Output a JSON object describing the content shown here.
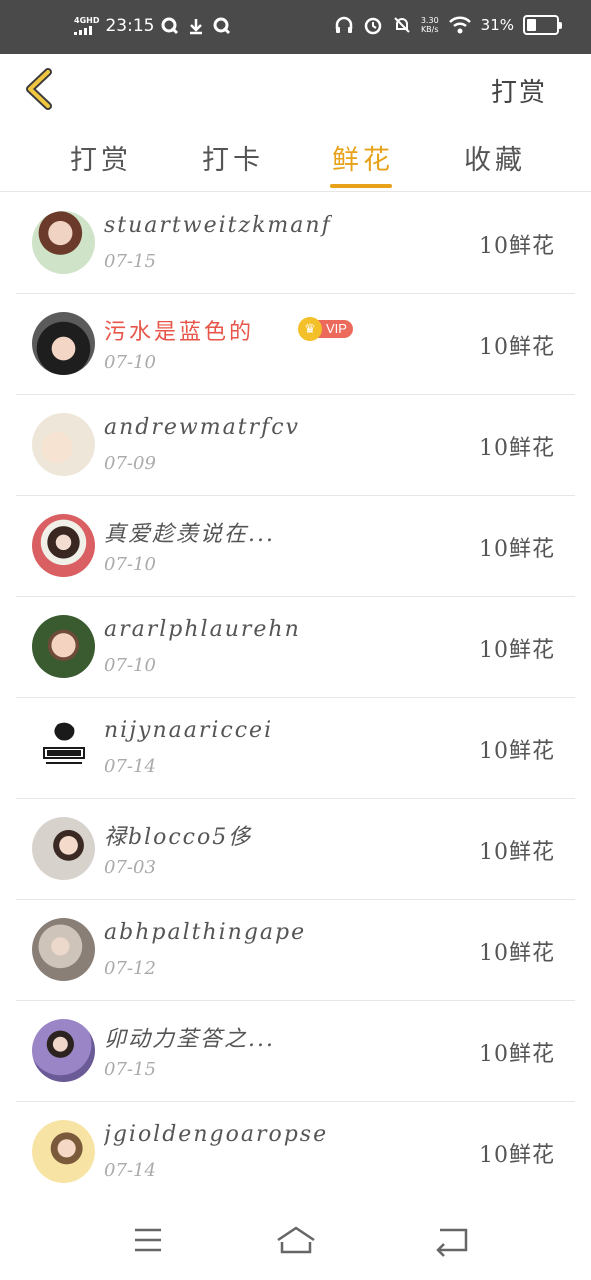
{
  "status_bar": {
    "network": "4GHD",
    "time": "23:15",
    "speed_top": "3.30",
    "speed_bottom": "KB/s",
    "battery": "31%"
  },
  "header": {
    "back_icon": "chevron-left-icon",
    "action_label": "打赏"
  },
  "tabs": [
    {
      "label": "打赏"
    },
    {
      "label": "打卡"
    },
    {
      "label": "鲜花",
      "active": true
    },
    {
      "label": "收藏"
    }
  ],
  "vip_label": "VIP",
  "list": [
    {
      "name": "stuartweitzkmanf",
      "date": "07-15",
      "amount": "10鲜花"
    },
    {
      "name": "污水是蓝色的",
      "date": "07-10",
      "amount": "10鲜花",
      "vip": true
    },
    {
      "name": "andrewmatrfcv",
      "date": "07-09",
      "amount": "10鲜花"
    },
    {
      "name": "真爱趁羡说在...",
      "date": "07-10",
      "amount": "10鲜花"
    },
    {
      "name": "ararlphlaurehn",
      "date": "07-10",
      "amount": "10鲜花"
    },
    {
      "name": "nijynaariccei",
      "date": "07-14",
      "amount": "10鲜花"
    },
    {
      "name": "禄blocco5侈",
      "date": "07-03",
      "amount": "10鲜花"
    },
    {
      "name": "abhpalthingape",
      "date": "07-12",
      "amount": "10鲜花"
    },
    {
      "name": "卯动力荃答之...",
      "date": "07-15",
      "amount": "10鲜花"
    },
    {
      "name": "jgioldengoaropse",
      "date": "07-14",
      "amount": "10鲜花"
    }
  ],
  "colors": {
    "accent": "#e8a21a",
    "vip_name": "#e8564a",
    "status_bar": "#4a4a4a"
  },
  "bottom_nav": [
    "menu-icon",
    "home-icon",
    "back-icon"
  ]
}
